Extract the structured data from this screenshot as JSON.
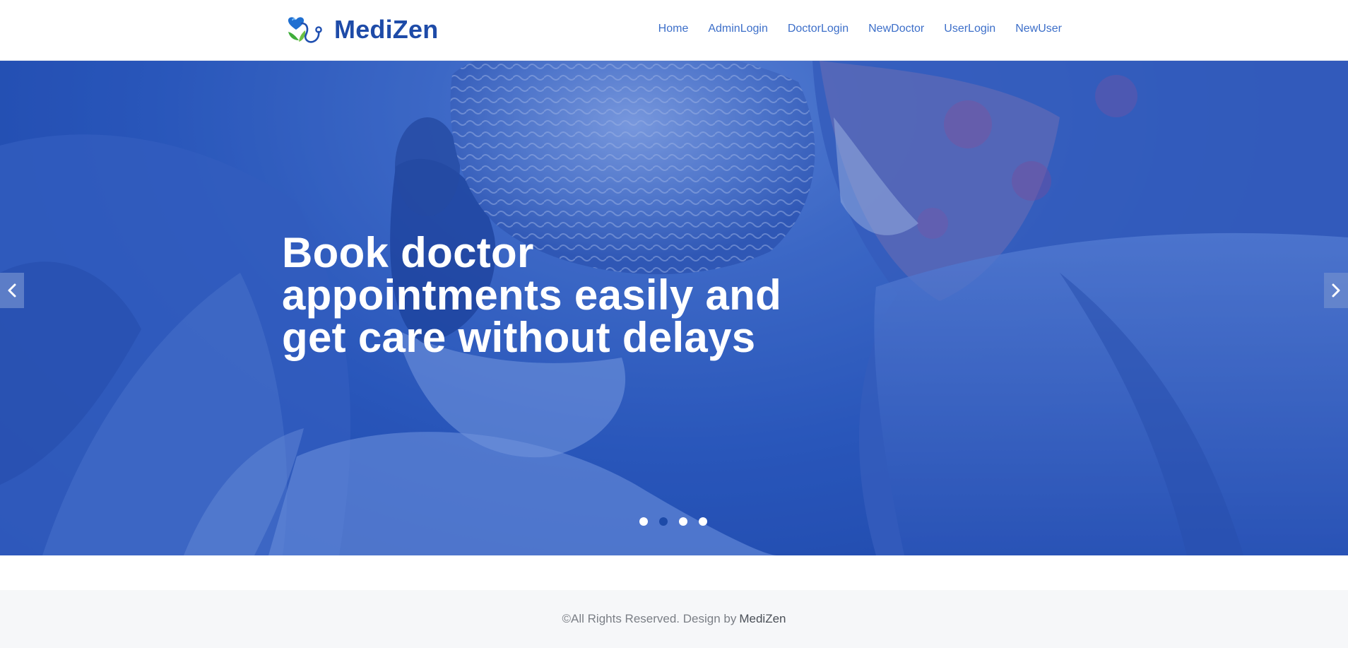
{
  "brand": {
    "name": "MediZen",
    "logo_icon": "heart-stethoscope-logo-icon",
    "color": "#1e4ba8"
  },
  "nav": {
    "items": [
      {
        "label": "Home"
      },
      {
        "label": "AdminLogin"
      },
      {
        "label": "DoctorLogin"
      },
      {
        "label": "NewDoctor"
      },
      {
        "label": "UserLogin"
      },
      {
        "label": "NewUser"
      }
    ],
    "color": "#3d6fc9"
  },
  "hero": {
    "headline_lines": [
      "Book doctor",
      "appointments easily and",
      "get care without delays"
    ],
    "prev_icon": "chevron-left-icon",
    "next_icon": "chevron-right-icon",
    "slides_total": 4,
    "active_slide": 2,
    "overlay_color": "#2a5bbf"
  },
  "footer": {
    "text": "©All Rights Reserved. Design by",
    "link": "MediZen"
  }
}
